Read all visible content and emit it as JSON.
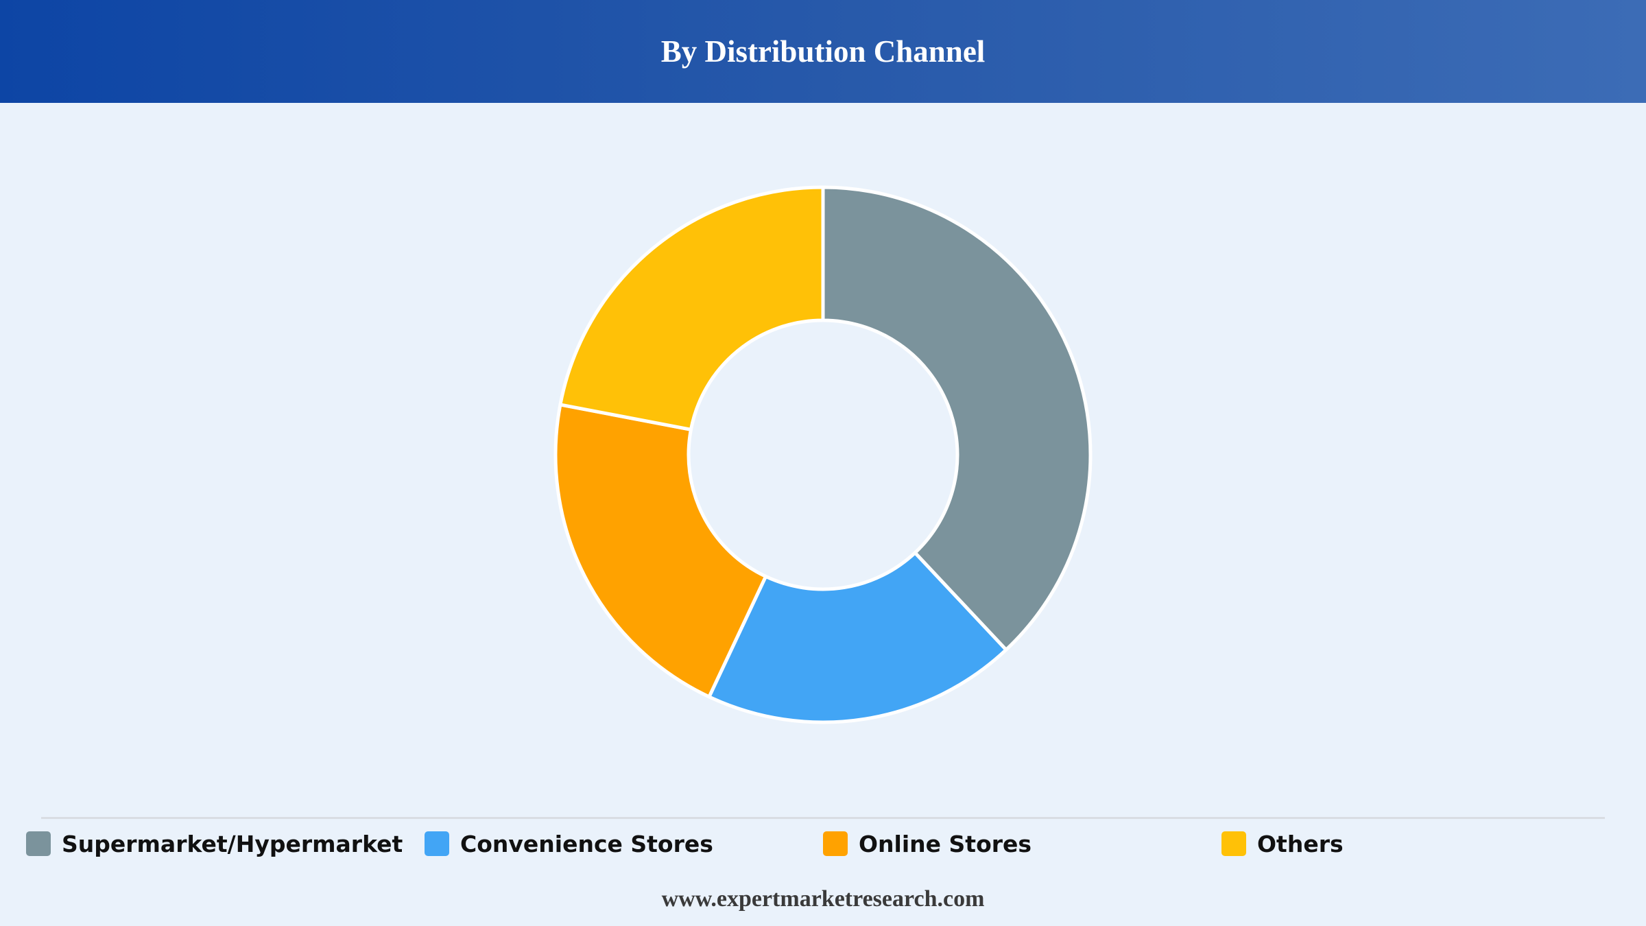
{
  "header": {
    "title": "By Distribution Channel"
  },
  "chart_data": {
    "type": "pie",
    "donut": true,
    "categories": [
      "Supermarket/Hypermarket",
      "Convenience Stores",
      "Online Stores",
      "Others"
    ],
    "values": [
      38,
      19,
      21,
      22
    ],
    "colors": [
      "#7b939c",
      "#42a5f5",
      "#ffa200",
      "#ffc107"
    ],
    "legend_position": "bottom"
  },
  "footer": {
    "url": "www.expertmarketresearch.com"
  }
}
